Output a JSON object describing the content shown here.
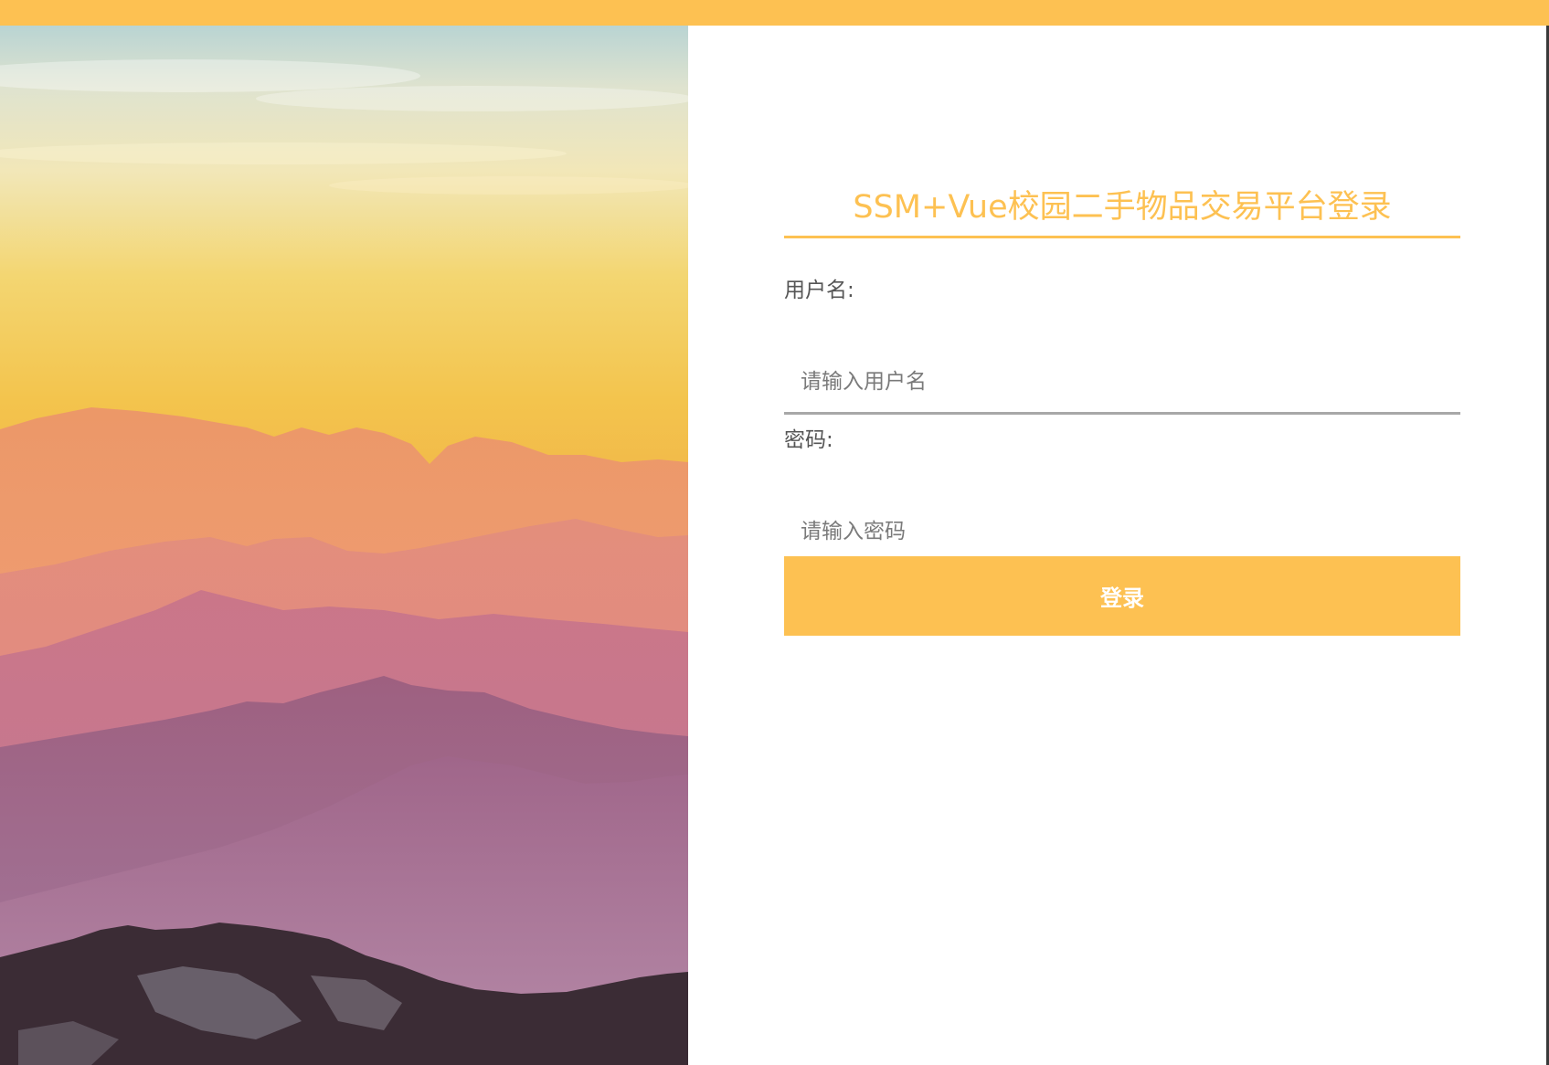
{
  "theme": {
    "accent": "#fdc152",
    "label_color": "#555555",
    "input_border": "#a8a8a8"
  },
  "hero": {
    "image_icon": "mountain-sunset-image"
  },
  "login": {
    "title": "SSM+Vue校园二手物品交易平台登录",
    "username_label": "用户名:",
    "username_placeholder": "请输入用户名",
    "username_value": "",
    "password_label": "密码:",
    "password_placeholder": "请输入密码",
    "password_value": "",
    "submit_label": "登录"
  }
}
